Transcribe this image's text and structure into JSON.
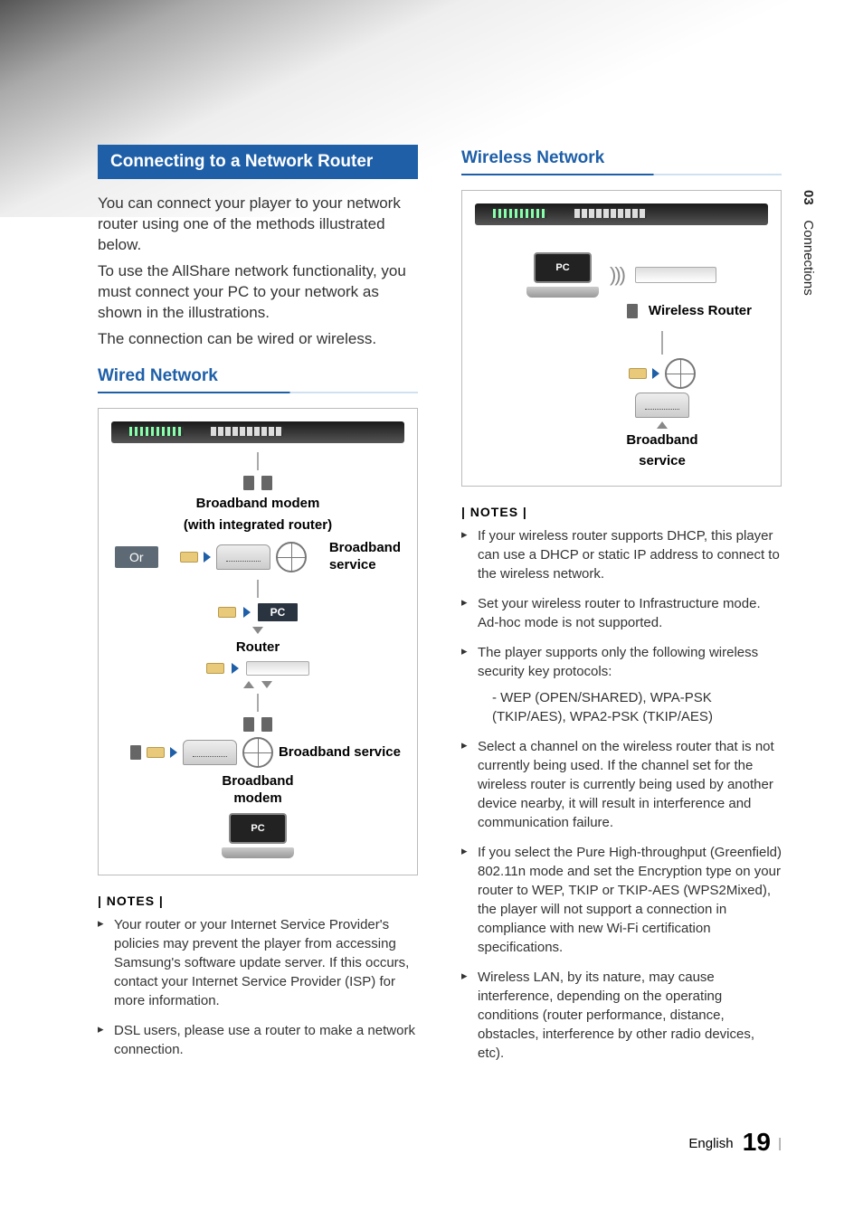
{
  "side_tab": {
    "chapter": "03",
    "title": "Connections"
  },
  "left": {
    "section_title": "Connecting to a Network Router",
    "para1": "You can connect your player to your network router using one of the methods illustrated below.",
    "para2": "To use the AllShare network functionality, you must connect your PC to your network as shown in the illustrations.",
    "para3": "The connection can be wired or wireless.",
    "wired_title": "Wired Network",
    "diagram": {
      "bb_modem_integrated_1": "Broadband modem",
      "bb_modem_integrated_2": "(with integrated router)",
      "broadband_service": "Broadband service",
      "or": "Or",
      "pc": "PC",
      "router": "Router",
      "broadband_modem_1": "Broadband",
      "broadband_modem_2": "modem"
    },
    "notes_hdr": "| NOTES |",
    "notes": [
      "Your router or your Internet Service Provider's policies may prevent the player from accessing Samsung's software update server. If this occurs, contact your Internet Service Provider (ISP) for more information.",
      "DSL users, please use a router to make a network connection."
    ]
  },
  "right": {
    "wireless_title": "Wireless Network",
    "diagram": {
      "pc": "PC",
      "wireless_router": "Wireless Router",
      "broadband_1": "Broadband",
      "broadband_2": "service"
    },
    "notes_hdr": "| NOTES |",
    "notes": [
      "If your wireless router supports DHCP, this player can use a DHCP or static IP address to connect to the wireless network.",
      "Set your wireless router to Infrastructure mode. Ad-hoc mode is not supported.",
      "The player supports only the following wireless security key protocols:",
      "Select a channel on the wireless router that is not currently being used. If the channel set for the wireless router is currently being used by another device nearby, it will result in interference and communication failure.",
      "If you select the Pure High-throughput (Greenfield) 802.11n mode and set the Encryption type on your router to WEP, TKIP or TKIP-AES (WPS2Mixed), the player will not support a connection in compliance with new Wi-Fi certification specifications.",
      "Wireless LAN, by its nature, may cause interference, depending on the operating conditions (router performance, distance, obstacles, interference by other radio devices, etc)."
    ],
    "sub_note": "WEP (OPEN/SHARED), WPA-PSK (TKIP/AES), WPA2-PSK (TKIP/AES)"
  },
  "footer": {
    "lang": "English",
    "page": "19"
  }
}
